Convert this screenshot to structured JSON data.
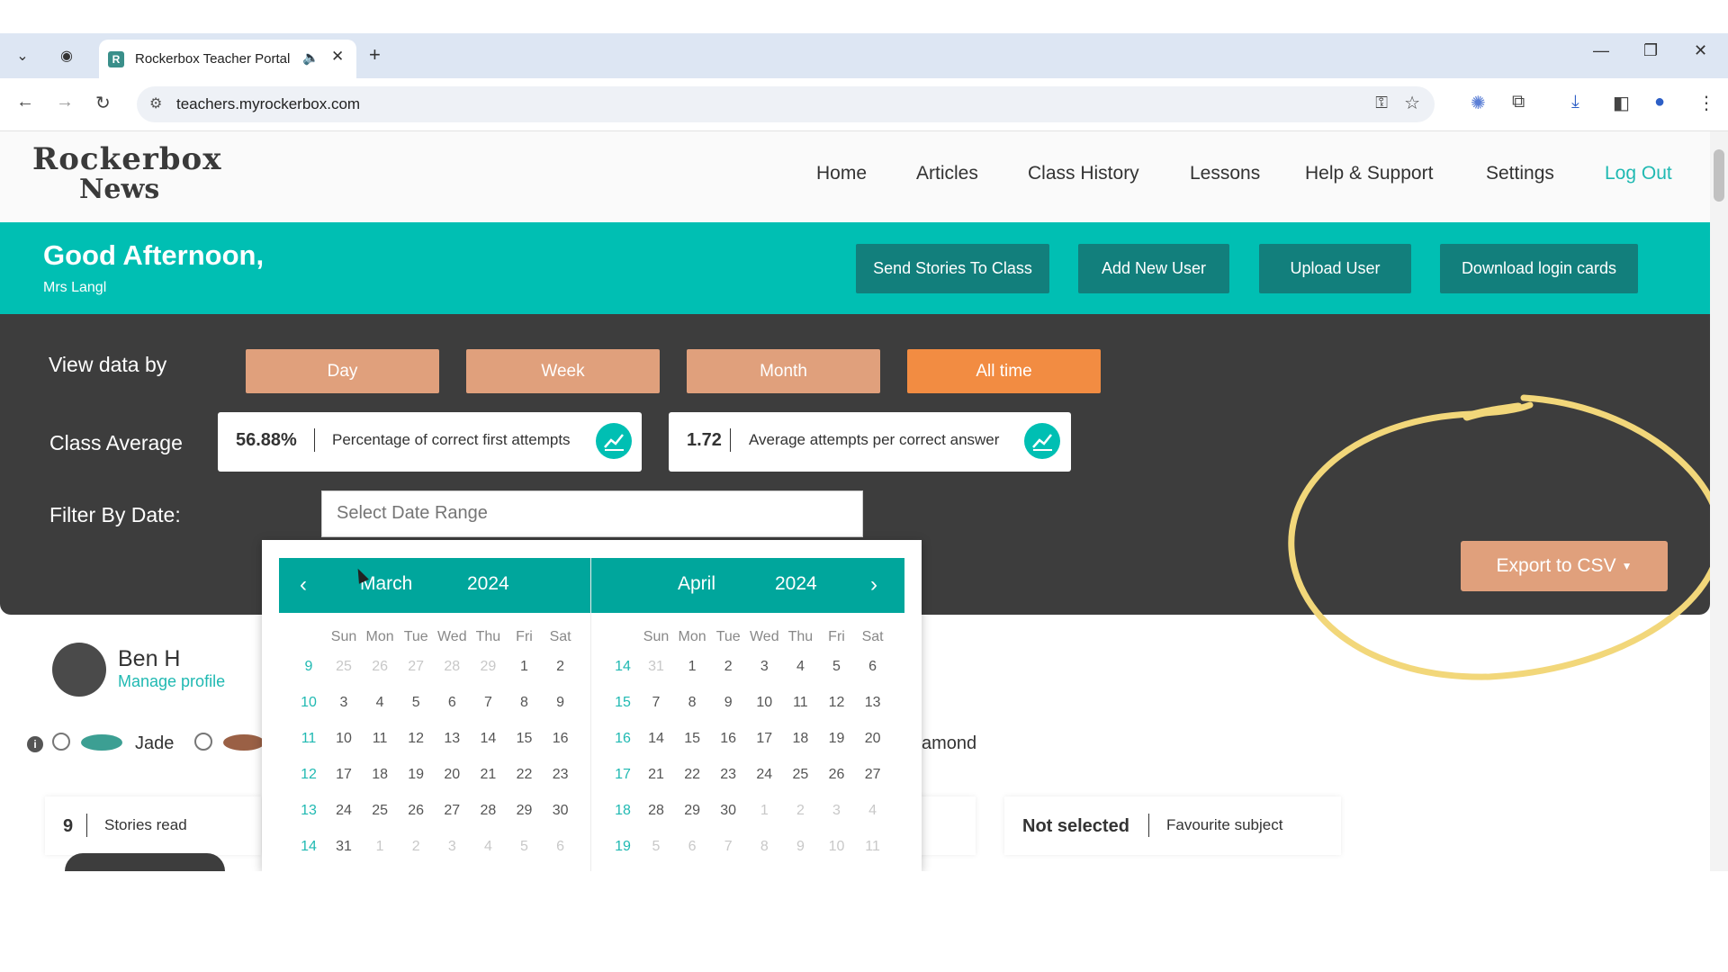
{
  "browser": {
    "tab_title": "Rockerbox Teacher Portal",
    "tab_favicon": "R",
    "url": "teachers.myrockerbox.com",
    "new_tab": "+",
    "icons": [
      "chevron-down-icon",
      "record-icon",
      "speaker-icon",
      "close-icon",
      "back-icon",
      "forward-icon",
      "reload-icon",
      "site-settings-icon",
      "key-icon",
      "star-icon",
      "extension-icon",
      "puzzle-icon",
      "download-icon",
      "sidepanel-icon",
      "profile-icon",
      "menu-icon",
      "minimize-icon",
      "restore-icon",
      "close-window-icon"
    ]
  },
  "site": {
    "logo_line1": "Rockerbox",
    "logo_line2": "News",
    "nav": [
      "Home",
      "Articles",
      "Class History",
      "Lessons",
      "Help & Support",
      "Settings",
      "Log Out"
    ]
  },
  "banner": {
    "greeting": "Good Afternoon,",
    "name": "Mrs Langl",
    "buttons": [
      "Send Stories To Class",
      "Add New User",
      "Upload User",
      "Download login cards"
    ]
  },
  "panel": {
    "view_label": "View data by",
    "ranges": [
      "Day",
      "Week",
      "Month",
      "All time"
    ],
    "active_range": "All time",
    "class_avg_label": "Class Average",
    "stats": [
      {
        "value": "56.88%",
        "desc": "Percentage of correct first attempts"
      },
      {
        "value": "1.72",
        "desc": "Average attempts per correct answer"
      }
    ],
    "filter_label": "Filter By Date:",
    "date_placeholder": "Select Date Range",
    "export_label": "Export to CSV"
  },
  "student": {
    "name": "Ben H",
    "manage": "Manage profile",
    "gem_visible": "Jade",
    "gem_partial": "amond",
    "cards": [
      {
        "value": "9",
        "desc": "Stories read"
      },
      {
        "value": "Not selected",
        "desc": "Favourite subject"
      }
    ]
  },
  "calendar": {
    "prev": "‹",
    "next": "›",
    "dow": [
      "Sun",
      "Mon",
      "Tue",
      "Wed",
      "Thu",
      "Fri",
      "Sat"
    ],
    "months": [
      {
        "month": "March",
        "year": "2024",
        "weeks": [
          "9",
          "10",
          "11",
          "12",
          "13",
          "14"
        ],
        "days": [
          [
            "25",
            "26",
            "27",
            "28",
            "29",
            "1",
            "2"
          ],
          [
            "3",
            "4",
            "5",
            "6",
            "7",
            "8",
            "9"
          ],
          [
            "10",
            "11",
            "12",
            "13",
            "14",
            "15",
            "16"
          ],
          [
            "17",
            "18",
            "19",
            "20",
            "21",
            "22",
            "23"
          ],
          [
            "24",
            "25",
            "26",
            "27",
            "28",
            "29",
            "30"
          ],
          [
            "31",
            "1",
            "2",
            "3",
            "4",
            "5",
            "6"
          ]
        ],
        "muted": [
          [
            0,
            0
          ],
          [
            0,
            1
          ],
          [
            0,
            2
          ],
          [
            0,
            3
          ],
          [
            0,
            4
          ],
          [
            5,
            1
          ],
          [
            5,
            2
          ],
          [
            5,
            3
          ],
          [
            5,
            4
          ],
          [
            5,
            5
          ],
          [
            5,
            6
          ]
        ]
      },
      {
        "month": "April",
        "year": "2024",
        "weeks": [
          "14",
          "15",
          "16",
          "17",
          "18",
          "19"
        ],
        "days": [
          [
            "31",
            "1",
            "2",
            "3",
            "4",
            "5",
            "6"
          ],
          [
            "7",
            "8",
            "9",
            "10",
            "11",
            "12",
            "13"
          ],
          [
            "14",
            "15",
            "16",
            "17",
            "18",
            "19",
            "20"
          ],
          [
            "21",
            "22",
            "23",
            "24",
            "25",
            "26",
            "27"
          ],
          [
            "28",
            "29",
            "30",
            "1",
            "2",
            "3",
            "4"
          ],
          [
            "5",
            "6",
            "7",
            "8",
            "9",
            "10",
            "11"
          ]
        ],
        "muted": [
          [
            0,
            0
          ],
          [
            4,
            3
          ],
          [
            4,
            4
          ],
          [
            4,
            5
          ],
          [
            4,
            6
          ],
          [
            5,
            0
          ],
          [
            5,
            1
          ],
          [
            5,
            2
          ],
          [
            5,
            3
          ],
          [
            5,
            4
          ],
          [
            5,
            5
          ],
          [
            5,
            6
          ]
        ]
      }
    ]
  },
  "colors": {
    "teal": "#00bfb3",
    "teal_dark": "#127f7c",
    "panel": "#3d3d3d",
    "peach": "#e0a07c",
    "orange": "#f28c42",
    "highlight_circle": "#f2d77a"
  }
}
